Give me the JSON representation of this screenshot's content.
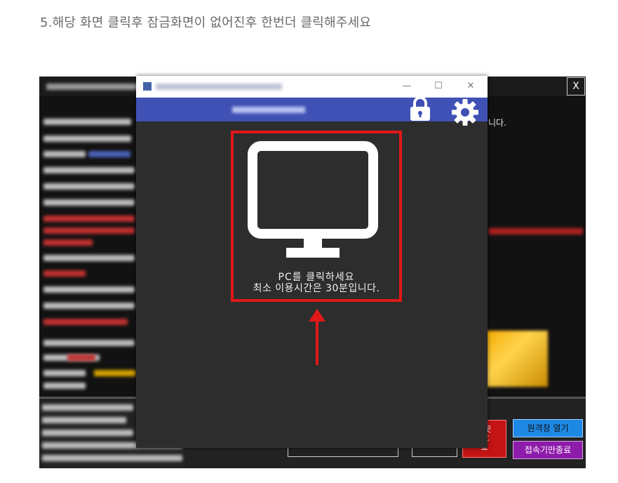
{
  "caption": "5.해당 화면 클릭후 잠금화면이 없어진후 한번더 클릭해주세요",
  "background_window": {
    "close_label": "X",
    "right_text": "니다.",
    "remote_button": "원격창 열기",
    "end_button": "접속기만종료",
    "red_button_lines": [
      "아웃",
      "PC",
      "료"
    ]
  },
  "dialog": {
    "window_controls": {
      "minimize": "—",
      "maximize": "☐",
      "close": "✕"
    },
    "message_line1": "PC를 클릭하세요",
    "message_line2": "최소 이용시간은 30분입니다."
  },
  "colors": {
    "header_blue": "#3f51b5",
    "highlight_red": "#e01818",
    "remote_blue": "#1e88e5",
    "end_purple": "#8e1caa"
  }
}
